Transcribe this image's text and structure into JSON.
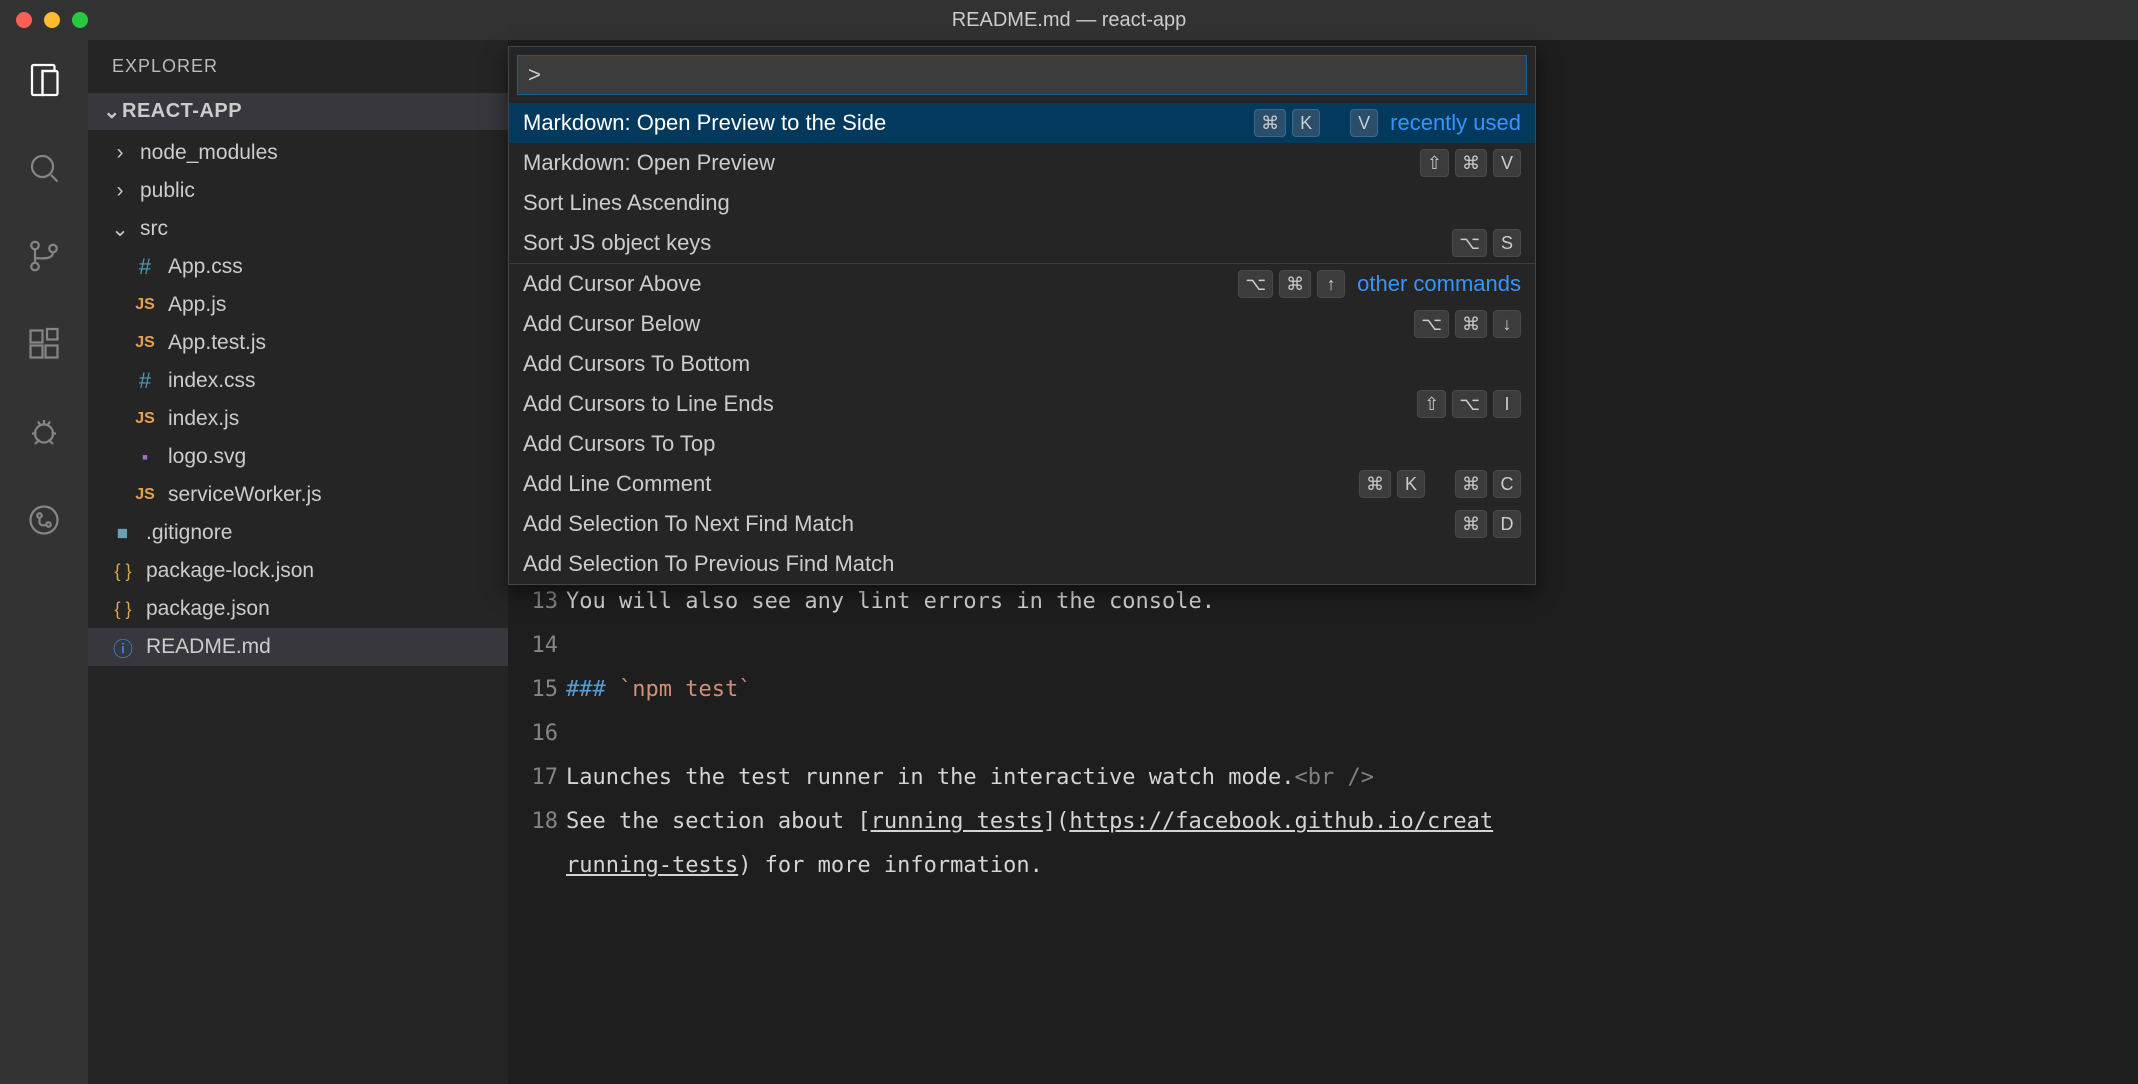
{
  "window": {
    "title": "README.md — react-app"
  },
  "sidebar": {
    "header": "EXPLORER",
    "folder": "REACT-APP",
    "items": [
      {
        "kind": "folder",
        "name": "node_modules",
        "expanded": false,
        "depth": 0
      },
      {
        "kind": "folder",
        "name": "public",
        "expanded": false,
        "depth": 0
      },
      {
        "kind": "folder",
        "name": "src",
        "expanded": true,
        "depth": 0
      },
      {
        "kind": "file",
        "name": "App.css",
        "icon": "hash",
        "depth": 1
      },
      {
        "kind": "file",
        "name": "App.js",
        "icon": "js",
        "depth": 1
      },
      {
        "kind": "file",
        "name": "App.test.js",
        "icon": "js",
        "depth": 1
      },
      {
        "kind": "file",
        "name": "index.css",
        "icon": "hash",
        "depth": 1
      },
      {
        "kind": "file",
        "name": "index.js",
        "icon": "js",
        "depth": 1
      },
      {
        "kind": "file",
        "name": "logo.svg",
        "icon": "img",
        "depth": 1
      },
      {
        "kind": "file",
        "name": "serviceWorker.js",
        "icon": "js",
        "depth": 1
      },
      {
        "kind": "file",
        "name": ".gitignore",
        "icon": "git",
        "depth": 0
      },
      {
        "kind": "file",
        "name": "package-lock.json",
        "icon": "json",
        "depth": 0
      },
      {
        "kind": "file",
        "name": "package.json",
        "icon": "json",
        "depth": 0
      },
      {
        "kind": "file",
        "name": "README.md",
        "icon": "info",
        "depth": 0,
        "selected": true
      }
    ]
  },
  "palette": {
    "input_value": ">",
    "groups": {
      "recent_label": "recently used",
      "other_label": "other commands"
    },
    "items": [
      {
        "label": "Markdown: Open Preview to the Side",
        "keys": [
          "⌘",
          "K",
          "",
          "V"
        ],
        "selected": true,
        "group_first": "recent"
      },
      {
        "label": "Markdown: Open Preview",
        "keys": [
          "⇧",
          "⌘",
          "V"
        ]
      },
      {
        "label": "Sort Lines Ascending",
        "keys": []
      },
      {
        "label": "Sort JS object keys",
        "keys": [
          "⌥",
          "S"
        ],
        "divider_after": true
      },
      {
        "label": "Add Cursor Above",
        "keys": [
          "⌥",
          "⌘",
          "↑"
        ],
        "group_first": "other"
      },
      {
        "label": "Add Cursor Below",
        "keys": [
          "⌥",
          "⌘",
          "↓"
        ]
      },
      {
        "label": "Add Cursors To Bottom",
        "keys": []
      },
      {
        "label": "Add Cursors to Line Ends",
        "keys": [
          "⇧",
          "⌥",
          "I"
        ]
      },
      {
        "label": "Add Cursors To Top",
        "keys": []
      },
      {
        "label": "Add Line Comment",
        "keys": [
          "⌘",
          "K",
          "",
          "⌘",
          "C"
        ]
      },
      {
        "label": "Add Selection To Next Find Match",
        "keys": [
          "⌘",
          "D"
        ]
      },
      {
        "label": "Add Selection To Previous Find Match",
        "keys": []
      }
    ]
  },
  "editor": {
    "lines": [
      {
        "n": 13,
        "text": "You will also see any lint errors in the console."
      },
      {
        "n": 14,
        "text": ""
      },
      {
        "n": 15,
        "heading": "###",
        "code": "`npm test`"
      },
      {
        "n": 16,
        "text": ""
      },
      {
        "n": 17,
        "plain": "Launches the test runner in the interactive watch mode.",
        "tag": "<br />"
      },
      {
        "n": 18,
        "pre": "See the section about [",
        "link_label": "running tests",
        "mid": "](",
        "link_url": "https://facebook.github.io/creat"
      },
      {
        "cont": true,
        "link_url2": "running-tests",
        "post": ") for more information."
      }
    ]
  }
}
